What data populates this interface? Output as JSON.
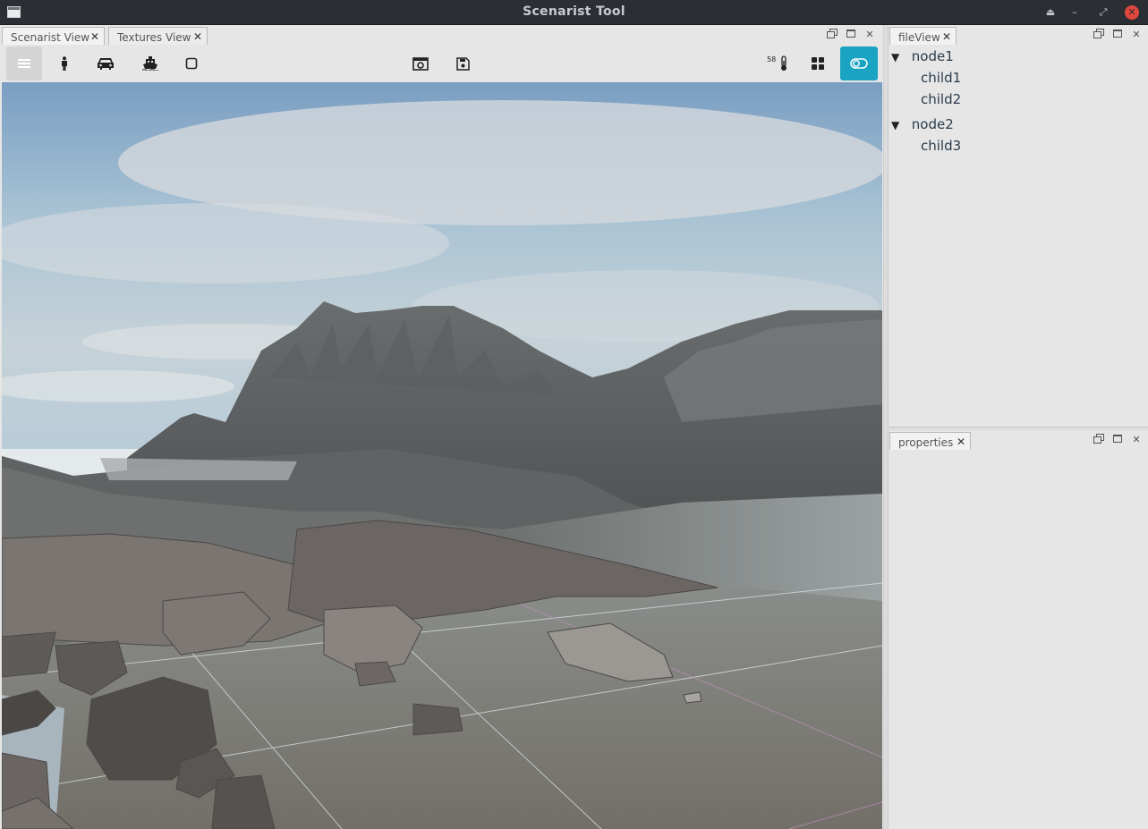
{
  "window": {
    "title": "Scenarist Tool"
  },
  "left_tabs": [
    {
      "label": "Scenarist View"
    },
    {
      "label": "Textures View"
    }
  ],
  "toolbar": {
    "temperature_value": "58",
    "icons": [
      "menu-icon",
      "person-icon",
      "car-icon",
      "ship-icon",
      "square-icon",
      "screenshot-icon",
      "save-icon",
      "thermometer-icon",
      "grid-icon",
      "toggle-icon"
    ],
    "accent_color": "#1aa3c2"
  },
  "file_view": {
    "tab_label": "fileView",
    "tree": [
      {
        "label": "node1",
        "children": [
          "child1",
          "child2"
        ]
      },
      {
        "label": "node2",
        "children": [
          "child3"
        ]
      }
    ]
  },
  "properties": {
    "tab_label": "properties"
  }
}
